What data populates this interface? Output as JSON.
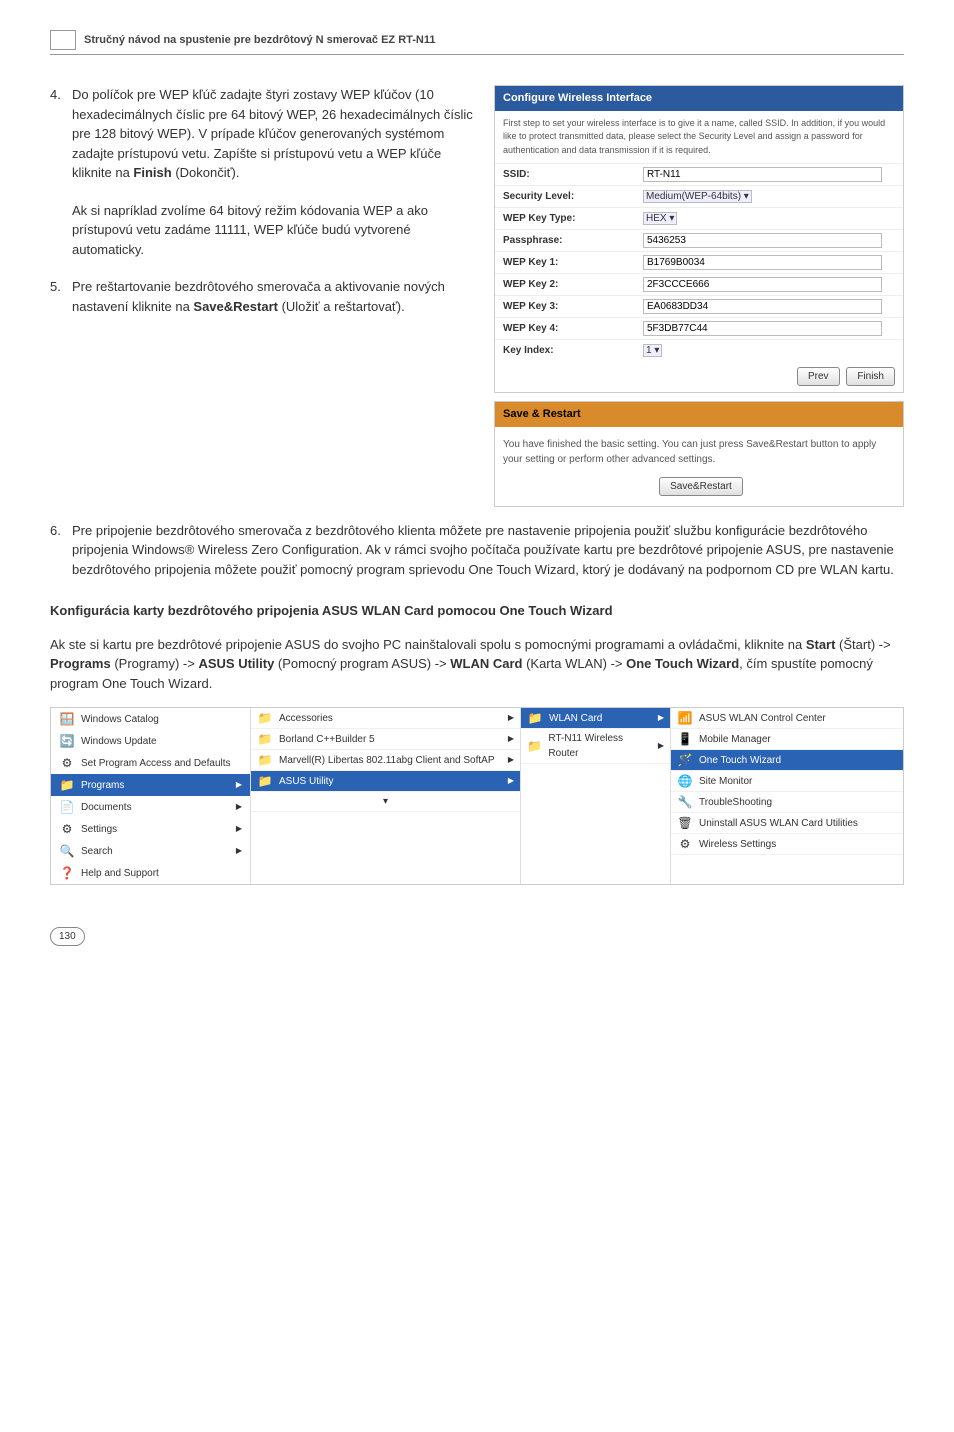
{
  "header": {
    "title": "Stručný návod na spustenie pre bezdrôtový N smerovač EZ RT-N11"
  },
  "step4": {
    "num": "4.",
    "body": "Do políčok pre WEP kľúč zadajte štyri zostavy WEP kľúčov (10 hexadecimálnych číslic pre 64 bitový WEP, 26 hexadecimálnych číslic pre 128 bitový WEP). V prípade kľúčov generovaných systémom zadajte prístupovú vetu. Zapíšte si prístupovú vetu a WEP kľúče kliknite na ",
    "bold": "Finish",
    "tail": " (Dokončiť).",
    "note": "Ak si napríklad zvolíme 64 bitový režim kódovania WEP a ako prístupovú vetu zadáme 11111, WEP kľúče budú vytvorené automaticky."
  },
  "step5": {
    "num": "5.",
    "body": "Pre reštartovanie bezdrôtového smerovača a aktivovanie nových nastavení kliknite na ",
    "bold": "Save&Restart",
    "tail": " (Uložiť a reštartovať)."
  },
  "cfg": {
    "title": "Configure Wireless Interface",
    "intro": "First step to set your wireless interface is to give it a name, called SSID. In addition, if you would like to protect transmitted data, please select the Security Level and assign a password for authentication and data transmission if it is required.",
    "rows": {
      "ssid_l": "SSID:",
      "ssid_v": "RT-N11",
      "sec_l": "Security Level:",
      "sec_v": "Medium(WEP-64bits)",
      "type_l": "WEP Key Type:",
      "type_v": "HEX",
      "pass_l": "Passphrase:",
      "pass_v": "5436253",
      "k1_l": "WEP Key 1:",
      "k1_v": "B1769B0034",
      "k2_l": "WEP Key 2:",
      "k2_v": "2F3CCCE666",
      "k3_l": "WEP Key 3:",
      "k3_v": "EA0683DD34",
      "k4_l": "WEP Key 4:",
      "k4_v": "5F3DB77C44",
      "idx_l": "Key Index:",
      "idx_v": "1"
    },
    "prev": "Prev",
    "finish": "Finish"
  },
  "save": {
    "title": "Save & Restart",
    "intro": "You have finished the basic setting. You can just press Save&Restart button to apply your setting or perform other advanced settings.",
    "btn": "Save&Restart"
  },
  "step6": {
    "num": "6.",
    "body": "Pre pripojenie bezdrôtového smerovača z bezdrôtového klienta môžete pre nastavenie pripojenia použiť službu konfigurácie bezdrôtového pripojenia Windows® Wireless Zero Configuration. Ak v rámci svojho počítača používate kartu pre bezdrôtové pripojenie ASUS, pre nastavenie bezdrôtového pripojenia môžete použiť pomocný program sprievodu One Touch Wizard, ktorý je dodávaný na podpornom CD pre WLAN kartu."
  },
  "sect": "Konfigurácia karty bezdrôtového pripojenia ASUS WLAN Card pomocou One Touch Wizard",
  "para": {
    "p1": "Ak ste si kartu pre bezdrôtové pripojenie ASUS do svojho PC nainštalovali spolu s pomocnými programami a ovládačmi, kliknite na ",
    "b1": "Start",
    "t1": " (Štart) -> ",
    "b2": "Programs",
    "t2": " (Programy) -> ",
    "b3": "ASUS Utility",
    "t3": " (Pomocný program ASUS) -> ",
    "b4": "WLAN Card",
    "t4": " (Karta WLAN) -> ",
    "b5": "One Touch Wizard",
    "t5": ", čím spustíte pomocný program One Touch Wizard."
  },
  "sm": {
    "left": {
      "catalog": "Windows Catalog",
      "update": "Windows Update",
      "defaults": "Set Program Access and Defaults",
      "programs": "Programs",
      "documents": "Documents",
      "settings": "Settings",
      "search": "Search",
      "help": "Help and Support"
    },
    "mid": {
      "acc": "Accessories",
      "borland": "Borland C++Builder 5",
      "marvell": "Marvell(R) Libertas 802.11abg Client and SoftAP",
      "asus": "ASUS Utility",
      "more": "▾"
    },
    "mid2": {
      "wlan": "WLAN Card",
      "router": "RT-N11 Wireless Router"
    },
    "right": {
      "ctrl": "ASUS WLAN Control Center",
      "mobile": "Mobile Manager",
      "otw": "One Touch Wizard",
      "site": "Site Monitor",
      "trouble": "TroubleShooting",
      "uninst": "Uninstall ASUS WLAN Card Utilities",
      "wset": "Wireless Settings"
    }
  },
  "page": "130"
}
